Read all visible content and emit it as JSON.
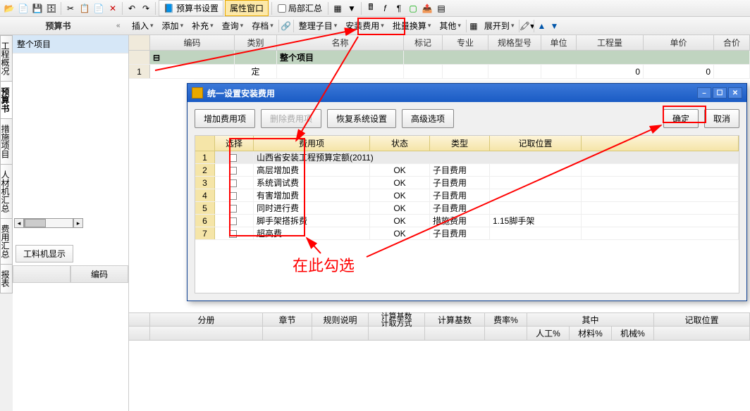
{
  "top_toolbar": {
    "budget_settings": "预算书设置",
    "prop_window": "属性窗口",
    "local_summary": "局部汇总"
  },
  "tree_header": "预算书",
  "menu": {
    "insert": "插入",
    "add": "添加",
    "supplement": "补充",
    "query": "查询",
    "archive": "存档",
    "sub_items": "整理子目",
    "install_fee": "安装费用",
    "batch_convert": "批量换算",
    "other": "其他",
    "expand_to": "展开到"
  },
  "tree": {
    "root": "整个项目"
  },
  "vtabs": [
    "工程概况",
    "预算书",
    "措施项目",
    "人材机汇总",
    "费用汇总",
    "报表"
  ],
  "active_vtab": 1,
  "grid": {
    "cols": {
      "code": "编码",
      "type": "类别",
      "name": "名称",
      "mark": "标记",
      "major": "专业",
      "spec": "规格型号",
      "unit": "单位",
      "qty": "工程量",
      "uprice": "单价",
      "total": "合价"
    },
    "group_row": "整个项目",
    "row1": {
      "num": "1",
      "type": "定",
      "qty": "0",
      "uprice": "0"
    }
  },
  "mini_tab": "工料机显示",
  "mini_head": "编码",
  "bottom": {
    "fence": "分册",
    "chapter": "章节",
    "rule": "规则说明",
    "basis_method": "计算基数\n计取方式",
    "basis": "计算基数",
    "rate": "费率%",
    "among": "其中",
    "labor": "人工%",
    "mat": "材料%",
    "mach": "机械%",
    "pos": "记取位置"
  },
  "dialog": {
    "title": "统一设置安装费用",
    "btn_add": "增加费用项",
    "btn_del": "删除费用项",
    "btn_restore": "恢复系统设置",
    "btn_adv": "高级选项",
    "btn_ok": "确定",
    "btn_cancel": "取消",
    "cols": {
      "select": "选择",
      "item": "费用项",
      "status": "状态",
      "type": "类型",
      "pos": "记取位置"
    },
    "group": "山西省安装工程预算定额(2011)",
    "rows": [
      {
        "n": "2",
        "item": "高层增加费",
        "status": "OK",
        "type": "子目费用",
        "pos": ""
      },
      {
        "n": "3",
        "item": "系统调试费",
        "status": "OK",
        "type": "子目费用",
        "pos": ""
      },
      {
        "n": "4",
        "item": "有害增加费",
        "status": "OK",
        "type": "子目费用",
        "pos": ""
      },
      {
        "n": "5",
        "item": "同时进行费",
        "status": "OK",
        "type": "子目费用",
        "pos": ""
      },
      {
        "n": "6",
        "item": "脚手架搭拆费",
        "status": "OK",
        "type": "措施费用",
        "pos": "1.15脚手架"
      },
      {
        "n": "7",
        "item": "超高费",
        "status": "OK",
        "type": "子目费用",
        "pos": ""
      }
    ]
  },
  "annotation_text": "在此勾选"
}
